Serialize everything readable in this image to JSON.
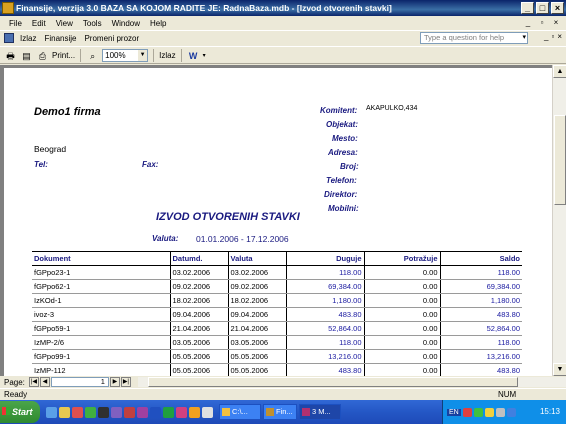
{
  "window": {
    "title": "Finansije, verzija 3.0      BAZA SA KOJOM RADITE JE: RadnaBaza.mdb - [Izvod otvorenih stavki]"
  },
  "menu": [
    "File",
    "Edit",
    "View",
    "Tools",
    "Window",
    "Help"
  ],
  "custom_menu": [
    "Izlaz",
    "Finansije",
    "Promeni prozor"
  ],
  "ask_box": {
    "placeholder": "Type a question for help"
  },
  "toolbar": {
    "print_label": "Print...",
    "zoom": "100%",
    "close_label": "Izlaz"
  },
  "report": {
    "firm": "Demo1 firma",
    "city": "Beograd",
    "tel_label": "Tel:",
    "fax_label": "Fax:",
    "komitent_label": "Komitent:",
    "komitent_value": "AKAPULKO,434",
    "fields": [
      "Objekat:",
      "Mesto:",
      "Adresa:",
      "Broj:",
      "Telefon:",
      "Direktor:",
      "Mobilni:"
    ],
    "title": "IZVOD OTVORENIH STAVKI",
    "valuta_label": "Valuta:",
    "valuta_range": "01.01.2006 - 17.12.2006",
    "columns": [
      "Dokument",
      "Datumd.",
      "Valuta",
      "Duguje",
      "Potražuje",
      "Saldo"
    ],
    "rows": [
      [
        "fGPpo23-1",
        "03.02.2006",
        "03.02.2006",
        "118.00",
        "0.00",
        "118.00"
      ],
      [
        "fGPpo62-1",
        "09.02.2006",
        "09.02.2006",
        "69,384.00",
        "0.00",
        "69,384.00"
      ],
      [
        "IzKOd-1",
        "18.02.2006",
        "18.02.2006",
        "1,180.00",
        "0.00",
        "1,180.00"
      ],
      [
        "ivoz-3",
        "09.04.2006",
        "09.04.2006",
        "483.80",
        "0.00",
        "483.80"
      ],
      [
        "fGPpo59-1",
        "21.04.2006",
        "21.04.2006",
        "52,864.00",
        "0.00",
        "52,864.00"
      ],
      [
        "IzMP-2/6",
        "03.05.2006",
        "03.05.2006",
        "118.00",
        "0.00",
        "118.00"
      ],
      [
        "fGPpo99-1",
        "05.05.2006",
        "05.05.2006",
        "13,216.00",
        "0.00",
        "13,216.00"
      ],
      [
        "IzMP-112",
        "05.05.2006",
        "05.05.2006",
        "483.80",
        "0.00",
        "483.80"
      ]
    ]
  },
  "navigation": {
    "page_label": "Page:",
    "page_value": "1"
  },
  "status": {
    "text": "Ready",
    "num": "NUM"
  },
  "taskbar": {
    "start": "Start",
    "tasks": [
      "C:\\...",
      "Fin...",
      "3 M..."
    ],
    "clock": "15:13",
    "lang": "EN"
  }
}
